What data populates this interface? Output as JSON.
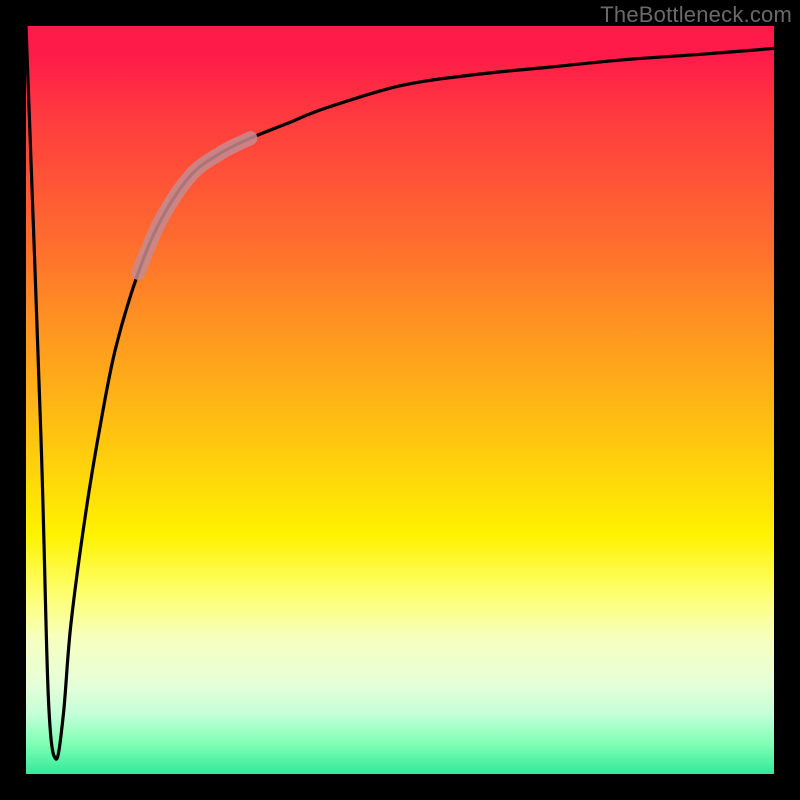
{
  "watermark": "TheBottleneck.com",
  "chart_data": {
    "type": "line",
    "title": "",
    "xlabel": "",
    "ylabel": "",
    "xlim": [
      0,
      100
    ],
    "ylim": [
      0,
      100
    ],
    "grid": false,
    "series": [
      {
        "name": "bottleneck-curve",
        "x": [
          0,
          2,
          3,
          4,
          5,
          6,
          8,
          10,
          12,
          15,
          18,
          22,
          26,
          30,
          35,
          40,
          50,
          60,
          70,
          80,
          90,
          100
        ],
        "values": [
          100,
          45,
          10,
          2,
          8,
          20,
          35,
          47,
          57,
          67,
          74,
          80,
          83,
          85,
          87,
          89,
          92,
          93.5,
          94.5,
          95.5,
          96.2,
          97
        ]
      }
    ],
    "highlight_segment": {
      "x_start": 18,
      "x_end": 26
    }
  }
}
